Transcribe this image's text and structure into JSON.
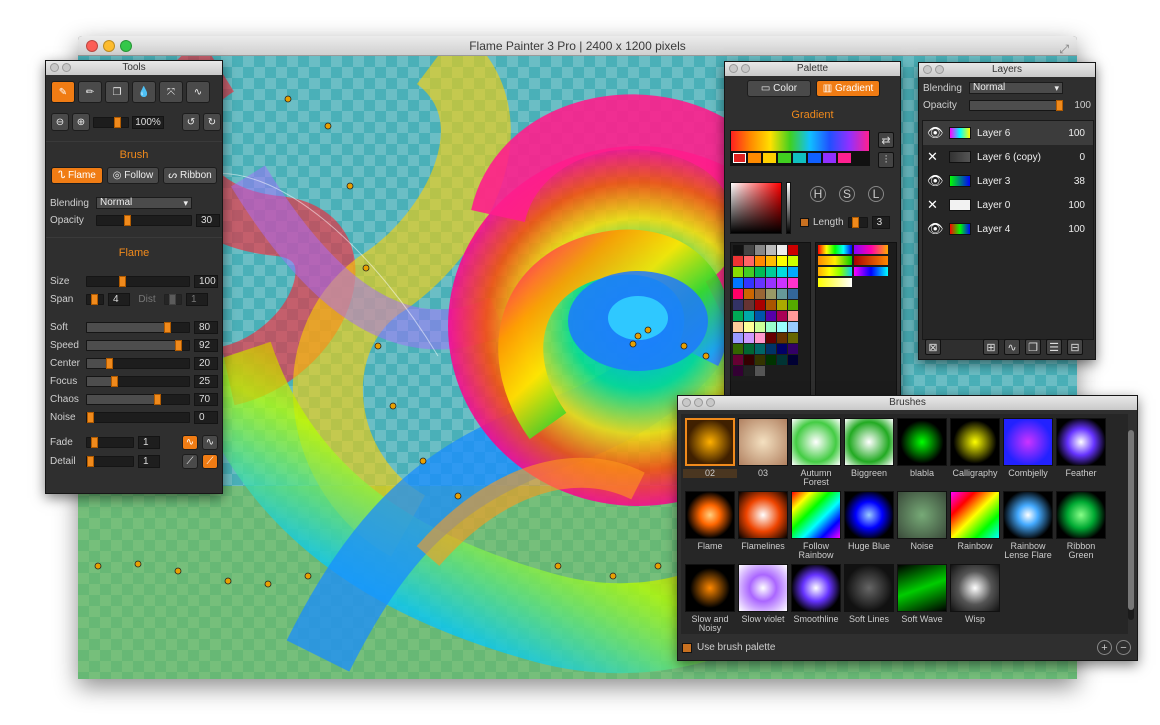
{
  "window": {
    "title": "Flame Painter 3 Pro | 2400 x 1200 pixels"
  },
  "tools": {
    "title": "Tools",
    "zoom": "100%",
    "brush_section": "Brush",
    "brush_types": [
      "Flame",
      "Follow",
      "Ribbon"
    ],
    "blending_label": "Blending",
    "blending_value": "Normal",
    "opacity_label": "Opacity",
    "opacity_value": "30",
    "flame_section": "Flame",
    "size_label": "Size",
    "size_value": "100",
    "span_label": "Span",
    "span_value": "4",
    "dist_label": "Dist",
    "dist_value": "1",
    "params": [
      {
        "label": "Soft",
        "value": "80",
        "pct": 0.8
      },
      {
        "label": "Speed",
        "value": "92",
        "pct": 0.92
      },
      {
        "label": "Center",
        "value": "20",
        "pct": 0.2
      },
      {
        "label": "Focus",
        "value": "25",
        "pct": 0.25
      },
      {
        "label": "Chaos",
        "value": "70",
        "pct": 0.7
      },
      {
        "label": "Noise",
        "value": "0",
        "pct": 0.0
      }
    ],
    "fade_label": "Fade",
    "fade_value": "1",
    "detail_label": "Detail",
    "detail_value": "1"
  },
  "palette": {
    "title": "Palette",
    "tab_color": "Color",
    "tab_gradient": "Gradient",
    "section": "Gradient",
    "hsl": [
      "H",
      "S",
      "L"
    ],
    "length_label": "Length",
    "length_value": "3"
  },
  "layers": {
    "title": "Layers",
    "blending_label": "Blending",
    "blending_value": "Normal",
    "opacity_label": "Opacity",
    "opacity_value": "100",
    "items": [
      {
        "name": "Layer 6",
        "value": "100",
        "visible": true,
        "selected": true
      },
      {
        "name": "Layer 6 (copy)",
        "value": "0",
        "visible": false,
        "selected": false
      },
      {
        "name": "Layer 3",
        "value": "38",
        "visible": true,
        "selected": false
      },
      {
        "name": "Layer 0",
        "value": "100",
        "visible": false,
        "selected": false
      },
      {
        "name": "Layer 4",
        "value": "100",
        "visible": true,
        "selected": false
      }
    ]
  },
  "brushes": {
    "title": "Brushes",
    "items": [
      "02",
      "03",
      "Autumn Forest",
      "Biggreen",
      "blabla",
      "Calligraphy",
      "Combjelly",
      "Feather",
      "Flame",
      "Flamelines",
      "Follow Rainbow",
      "Huge Blue",
      "Noise",
      "Rainbow",
      "Rainbow Lense Flare",
      "Ribbon Green",
      "Slow and Noisy",
      "Slow violet",
      "Smoothline",
      "Soft Lines",
      "Soft Wave",
      "Wisp"
    ],
    "use_palette_label": "Use brush palette"
  },
  "colors": {
    "accent": "#f07c14",
    "panel": "#2f2f2f"
  }
}
